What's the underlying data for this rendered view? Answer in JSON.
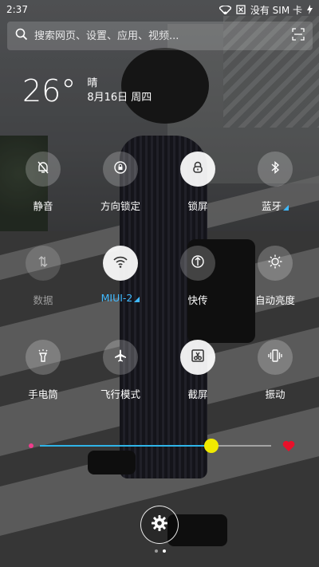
{
  "status_bar": {
    "time": "2:37",
    "carrier": "没有 SIM 卡"
  },
  "search": {
    "placeholder": "搜索网页、设置、应用、视频..."
  },
  "weather": {
    "temperature": "26°",
    "condition": "晴",
    "date": "8月16日 周四"
  },
  "toggles": [
    {
      "label": "静音",
      "icon": "bell-off-icon",
      "state": "off"
    },
    {
      "label": "方向锁定",
      "icon": "rotation-lock-icon",
      "state": "off"
    },
    {
      "label": "锁屏",
      "icon": "lock-icon",
      "state": "on"
    },
    {
      "label": "蓝牙",
      "icon": "bluetooth-icon",
      "state": "off"
    },
    {
      "label": "数据",
      "icon": "mobile-data-icon",
      "state": "disabled"
    },
    {
      "label": "MIUI-2",
      "icon": "wifi-icon",
      "state": "on"
    },
    {
      "label": "快传",
      "icon": "quick-transfer-icon",
      "state": "off"
    },
    {
      "label": "自动亮度",
      "icon": "brightness-icon",
      "state": "off"
    },
    {
      "label": "手电筒",
      "icon": "flashlight-icon",
      "state": "off"
    },
    {
      "label": "飞行模式",
      "icon": "airplane-icon",
      "state": "off"
    },
    {
      "label": "截屏",
      "icon": "screenshot-icon",
      "state": "on"
    },
    {
      "label": "振动",
      "icon": "vibrate-icon",
      "state": "off"
    }
  ],
  "brightness": {
    "level": 0.74,
    "accent": "#2fb4e8",
    "knob_color": "#f0ea00"
  },
  "pager": {
    "pages": 2,
    "current": 2
  },
  "colors": {
    "accent_text": "#40b9ff"
  }
}
